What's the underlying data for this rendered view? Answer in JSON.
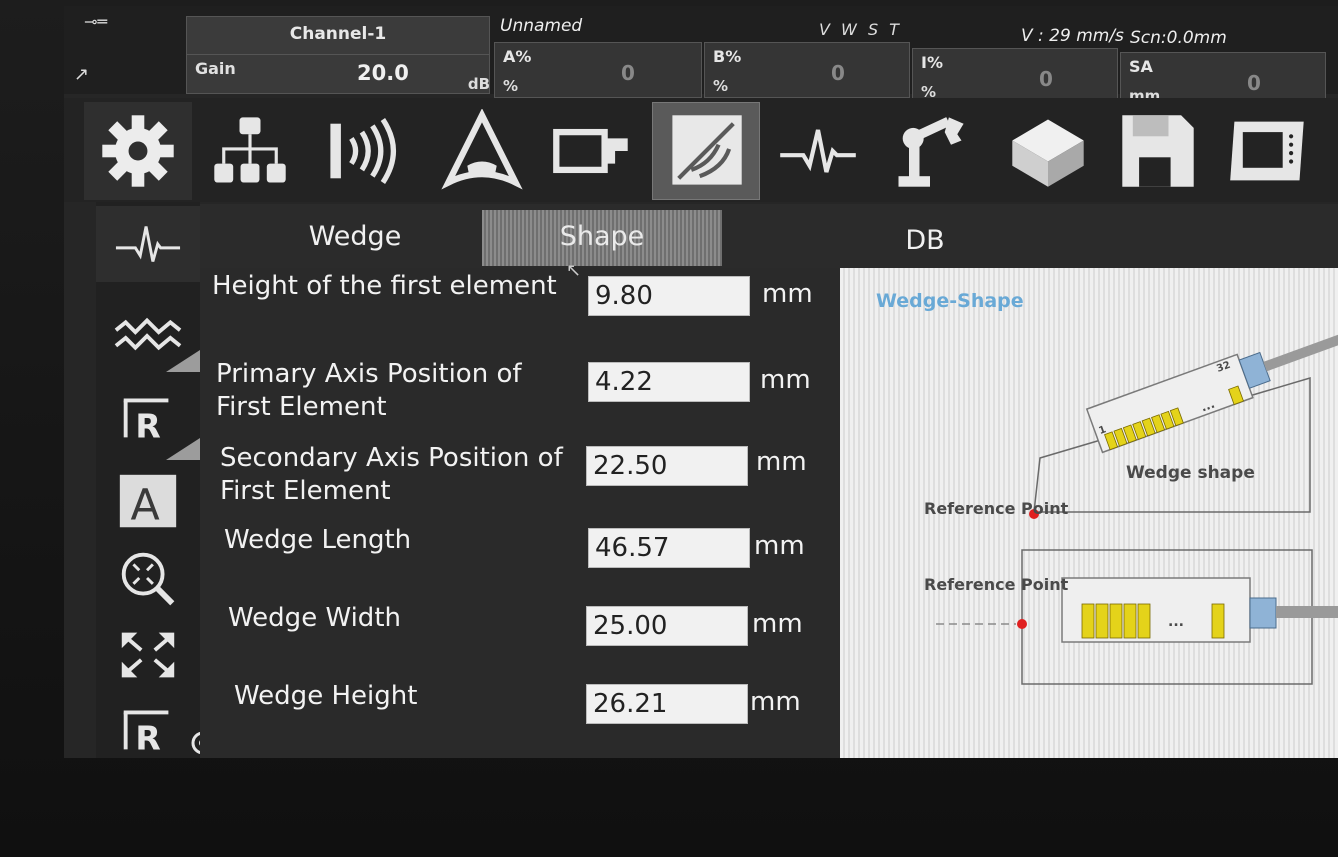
{
  "status": {
    "channel": "Channel-1",
    "gain_label": "Gain",
    "gain_value": "20.0",
    "gain_unit": "dB",
    "probe_name": "Unnamed",
    "modes": "V W S T",
    "velocity": "V : 29 mm/s",
    "scan": "Scn:0.0mm",
    "gates": [
      {
        "name": "A%",
        "unit": "%",
        "value": "0"
      },
      {
        "name": "B%",
        "unit": "%",
        "value": "0"
      },
      {
        "name": "I%",
        "unit": "%",
        "value": "0"
      },
      {
        "name": "SA",
        "unit": "mm",
        "value": "0"
      }
    ]
  },
  "toolbar": {
    "icons": [
      "gear-icon",
      "hierarchy-icon",
      "probe-waves-icon",
      "sector-scan-icon",
      "probe-wedge-icon",
      "wedge-shape-icon",
      "waveform-icon",
      "scanner-arm-icon",
      "part-block-icon",
      "save-disk-icon",
      "display-icon"
    ],
    "selected": "wedge-shape-icon"
  },
  "sidebar": {
    "icons": [
      "waveform-icon",
      "zigzag-icon",
      "reference-r-icon",
      "text-a-icon",
      "zoom-fit-icon",
      "expand-arrows-icon",
      "reference-r-icon",
      "target-icon"
    ]
  },
  "tabs": [
    {
      "label": "Wedge",
      "active": false
    },
    {
      "label": "Shape",
      "active": true
    },
    {
      "label": "DB",
      "active": false
    }
  ],
  "fields": [
    {
      "label": "Height of the first element",
      "value": "9.80",
      "unit": "mm"
    },
    {
      "label": "Primary Axis Position of First Element",
      "value": "4.22",
      "unit": "mm"
    },
    {
      "label": "Secondary Axis Position of First Element",
      "value": "22.50",
      "unit": "mm"
    },
    {
      "label": "Wedge Length",
      "value": "46.57",
      "unit": "mm"
    },
    {
      "label": "Wedge Width",
      "value": "25.00",
      "unit": "mm"
    },
    {
      "label": "Wedge Height",
      "value": "26.21",
      "unit": "mm"
    }
  ],
  "diagram": {
    "title": "Wedge-Shape",
    "wedge_label": "Wedge shape",
    "reference_point_1": "Reference Point",
    "reference_point_2": "Reference Point",
    "element_first": "1",
    "element_last": "32",
    "dots": "...",
    "colors": {
      "element": "#e4d31a",
      "connector": "#8fb3d6",
      "reference": "#e02020",
      "title": "#69a9d6"
    }
  }
}
